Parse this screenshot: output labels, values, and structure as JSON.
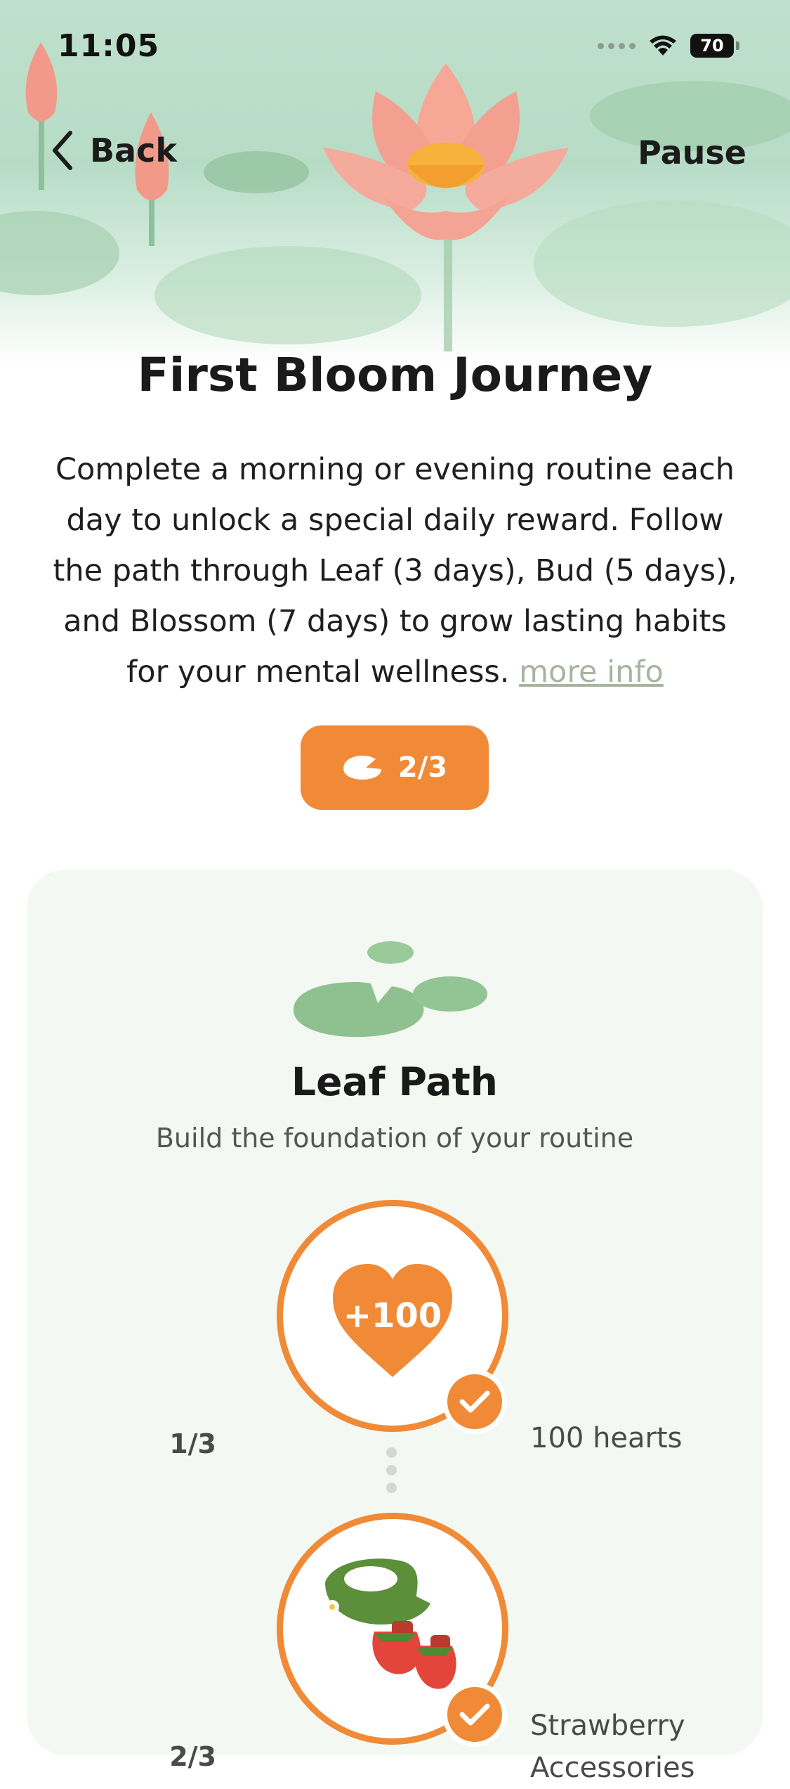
{
  "status_bar": {
    "time": "11:05",
    "battery": "70"
  },
  "nav": {
    "back_label": "Back",
    "pause_label": "Pause"
  },
  "journey": {
    "title": "First Bloom Journey",
    "description": "Complete a morning or evening routine each day to unlock a special daily reward.  Follow the path through Leaf (3 days), Bud (5 days), and Blossom (7 days) to grow lasting habits for your mental wellness.",
    "more_info_label": "more info",
    "progress_label": "2/3"
  },
  "path": {
    "title": "Leaf Path",
    "subtitle": "Build the foundation of your routine",
    "rewards": [
      {
        "count": "1/3",
        "badge": "+100",
        "name": "100 hearts",
        "completed": true
      },
      {
        "count": "2/3",
        "name_line1": "Strawberry",
        "name_line2": "Accessories",
        "completed": true
      }
    ]
  },
  "colors": {
    "accent": "#f08a36",
    "card_bg": "#f3f8f3",
    "link": "#a9b49f"
  },
  "icons": [
    "back-chevron-icon",
    "wifi-icon",
    "battery-icon",
    "lily-pad-icon",
    "heart-icon",
    "checkmark-icon",
    "strawberry-accessories-icon"
  ]
}
